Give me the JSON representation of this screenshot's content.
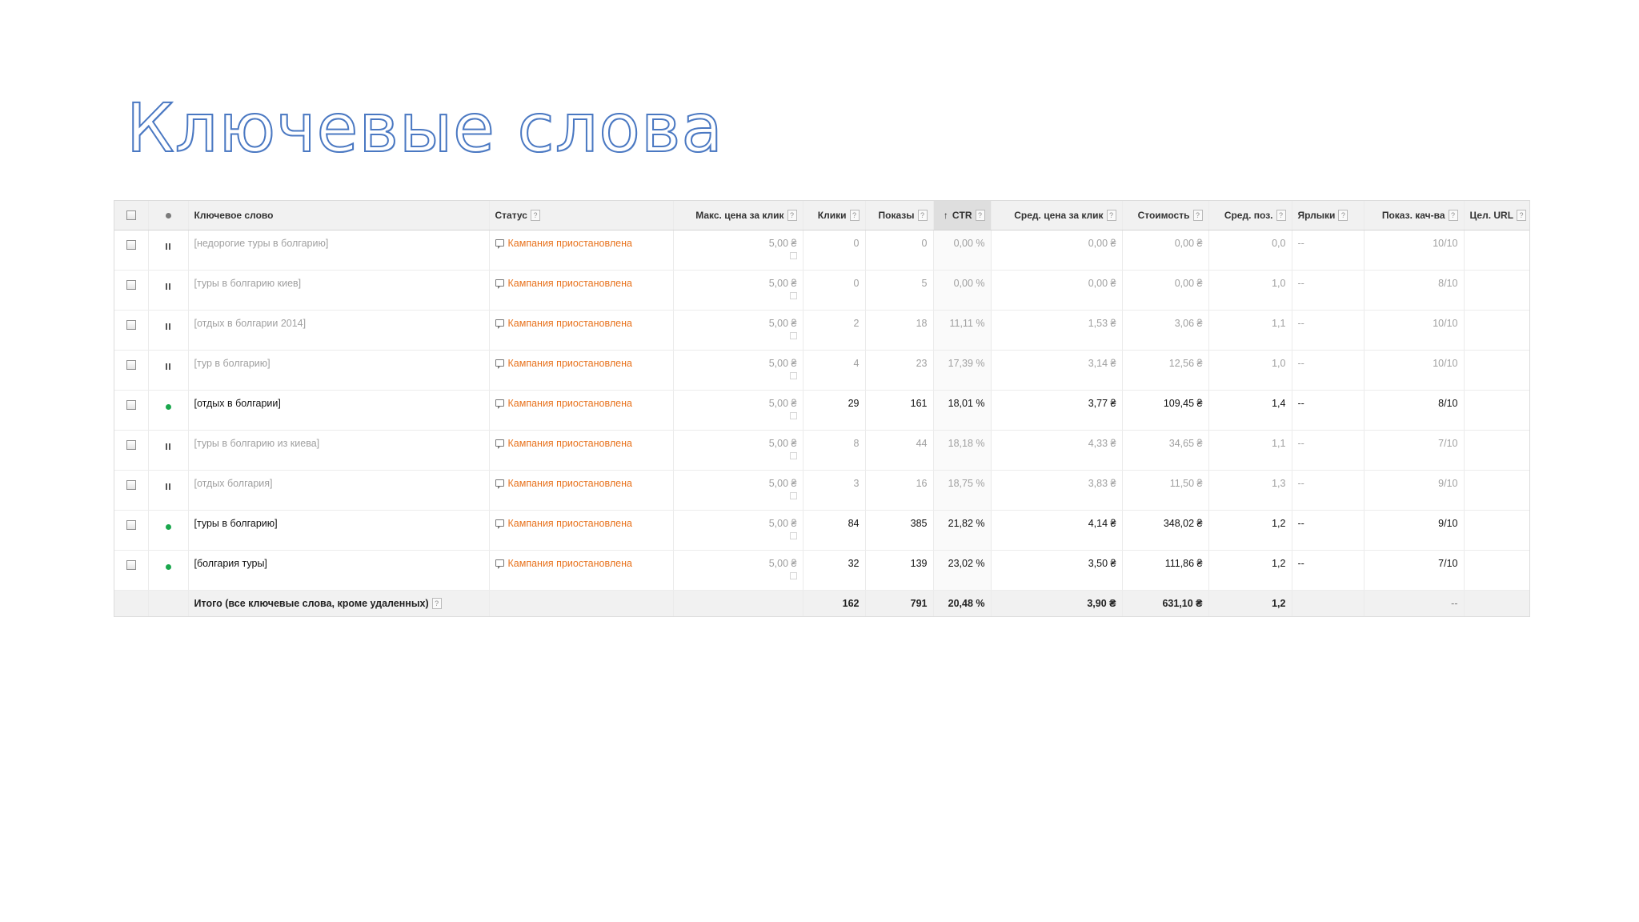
{
  "slide": {
    "title": "Ключевые слова"
  },
  "table": {
    "headers": {
      "keyword": "Ключевое слово",
      "status": "Статус",
      "max_cpc": "Макс. цена за клик",
      "clicks": "Клики",
      "impressions": "Показы",
      "ctr": "CTR",
      "avg_cpc": "Сред. цена за клик",
      "cost": "Стоимость",
      "avg_pos": "Сред. поз.",
      "labels": "Ярлыки",
      "quality": "Показ. кач-ва",
      "dest_url": "Цел. URL"
    },
    "help_glyph": "?",
    "sort_glyph": "↑",
    "rows": [
      {
        "state": "paused",
        "keyword": "[недорогие туры в болгарию]",
        "status": "Кампания приостановлена",
        "max_cpc": "5,00 ₴",
        "clicks": "0",
        "impressions": "0",
        "ctr": "0,00 %",
        "avg_cpc": "0,00 ₴",
        "cost": "0,00 ₴",
        "avg_pos": "0,0",
        "labels": "--",
        "quality": "10/10"
      },
      {
        "state": "paused",
        "keyword": "[туры в болгарию киев]",
        "status": "Кампания приостановлена",
        "max_cpc": "5,00 ₴",
        "clicks": "0",
        "impressions": "5",
        "ctr": "0,00 %",
        "avg_cpc": "0,00 ₴",
        "cost": "0,00 ₴",
        "avg_pos": "1,0",
        "labels": "--",
        "quality": "8/10"
      },
      {
        "state": "paused",
        "keyword": "[отдых в болгарии 2014]",
        "status": "Кампания приостановлена",
        "max_cpc": "5,00 ₴",
        "clicks": "2",
        "impressions": "18",
        "ctr": "11,11 %",
        "avg_cpc": "1,53 ₴",
        "cost": "3,06 ₴",
        "avg_pos": "1,1",
        "labels": "--",
        "quality": "10/10"
      },
      {
        "state": "paused",
        "keyword": "[тур в болгарию]",
        "status": "Кампания приостановлена",
        "max_cpc": "5,00 ₴",
        "clicks": "4",
        "impressions": "23",
        "ctr": "17,39 %",
        "avg_cpc": "3,14 ₴",
        "cost": "12,56 ₴",
        "avg_pos": "1,0",
        "labels": "--",
        "quality": "10/10"
      },
      {
        "state": "active",
        "keyword": "[отдых в болгарии]",
        "status": "Кампания приостановлена",
        "max_cpc": "5,00 ₴",
        "clicks": "29",
        "impressions": "161",
        "ctr": "18,01 %",
        "avg_cpc": "3,77 ₴",
        "cost": "109,45 ₴",
        "avg_pos": "1,4",
        "labels": "--",
        "quality": "8/10"
      },
      {
        "state": "paused",
        "keyword": "[туры в болгарию из киева]",
        "status": "Кампания приостановлена",
        "max_cpc": "5,00 ₴",
        "clicks": "8",
        "impressions": "44",
        "ctr": "18,18 %",
        "avg_cpc": "4,33 ₴",
        "cost": "34,65 ₴",
        "avg_pos": "1,1",
        "labels": "--",
        "quality": "7/10"
      },
      {
        "state": "paused",
        "keyword": "[отдых болгария]",
        "status": "Кампания приостановлена",
        "max_cpc": "5,00 ₴",
        "clicks": "3",
        "impressions": "16",
        "ctr": "18,75 %",
        "avg_cpc": "3,83 ₴",
        "cost": "11,50 ₴",
        "avg_pos": "1,3",
        "labels": "--",
        "quality": "9/10"
      },
      {
        "state": "active",
        "keyword": "[туры в болгарию]",
        "status": "Кампания приостановлена",
        "max_cpc": "5,00 ₴",
        "clicks": "84",
        "impressions": "385",
        "ctr": "21,82 %",
        "avg_cpc": "4,14 ₴",
        "cost": "348,02 ₴",
        "avg_pos": "1,2",
        "labels": "--",
        "quality": "9/10"
      },
      {
        "state": "active",
        "keyword": "[болгария туры]",
        "status": "Кампания приостановлена",
        "max_cpc": "5,00 ₴",
        "clicks": "32",
        "impressions": "139",
        "ctr": "23,02 %",
        "avg_cpc": "3,50 ₴",
        "cost": "111,86 ₴",
        "avg_pos": "1,2",
        "labels": "--",
        "quality": "7/10"
      }
    ],
    "totals": {
      "label": "Итого (все ключевые слова, кроме удаленных)",
      "clicks": "162",
      "impressions": "791",
      "ctr": "20,48 %",
      "avg_cpc": "3,90 ₴",
      "cost": "631,10 ₴",
      "avg_pos": "1,2",
      "quality": "--"
    },
    "colors": {
      "status_orange": "#e8721c",
      "active_green": "#1aa74d",
      "title_blue": "#4a78c2"
    }
  }
}
